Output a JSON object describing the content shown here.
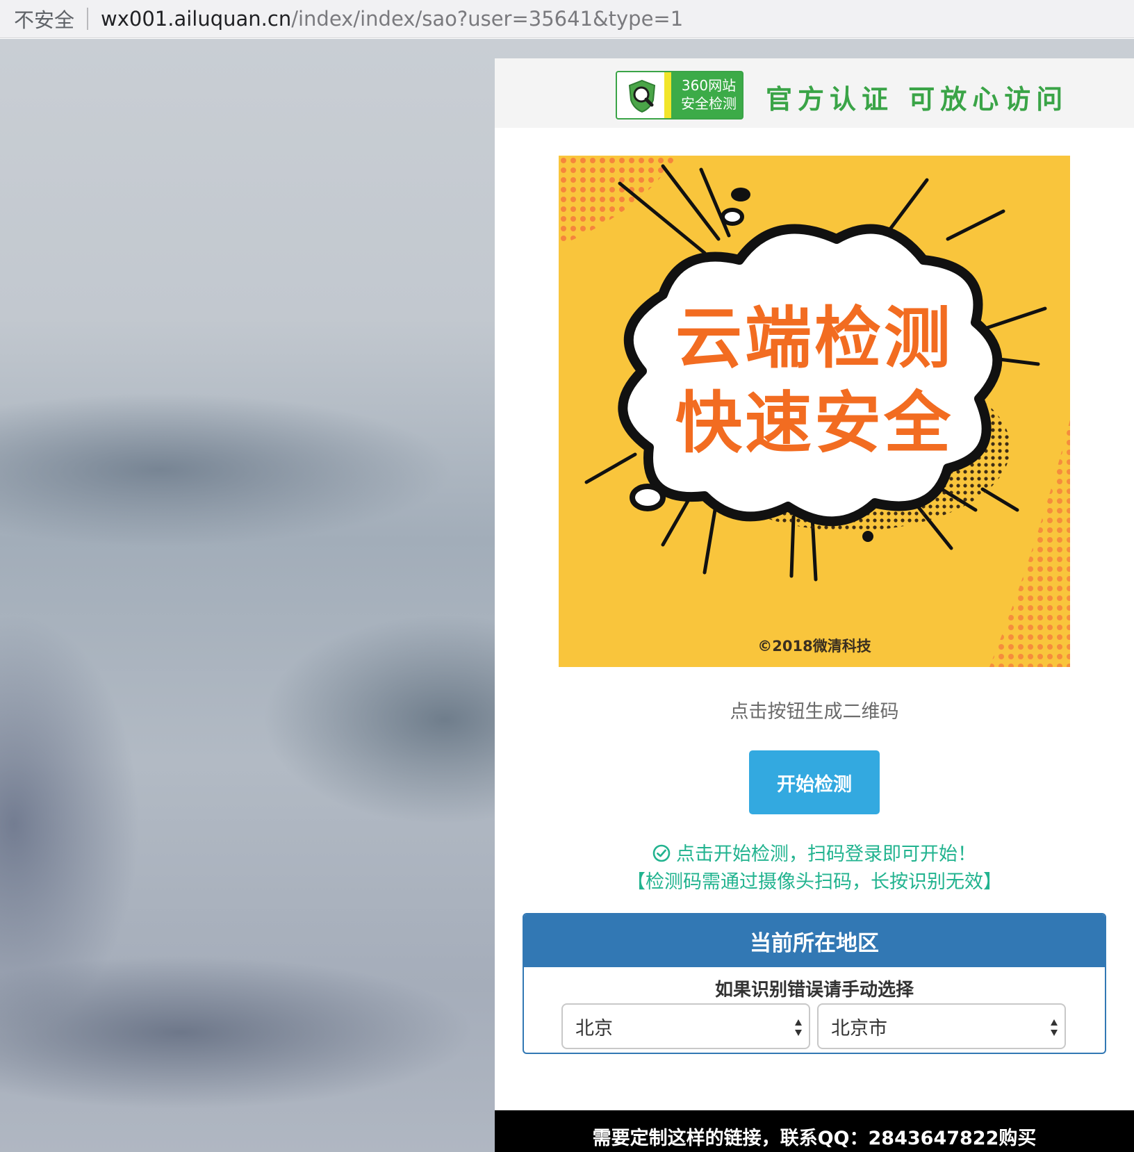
{
  "address_bar": {
    "security_label": "不安全",
    "host": "wx001.ailuquan.cn",
    "path": "/index/index/sao?user=35641&type=1"
  },
  "header": {
    "badge_line1": "360网站",
    "badge_line2": "安全检测",
    "slogan": "官方认证  可放心访问"
  },
  "hero": {
    "line1": "云端检测",
    "line2": "快速安全",
    "copyright": "©2018微清科技",
    "background_color": "#f9c53c",
    "text_color": "#f26c21"
  },
  "hint_text": "点击按钮生成二维码",
  "start_button_label": "开始检测",
  "notice": {
    "line1": "点击开始检测，扫码登录即可开始！",
    "line2": "【检测码需通过摄像头扫码，长按识别无效】",
    "icon": "check-circle-icon",
    "color": "#22b38f"
  },
  "region": {
    "title": "当前所在地区",
    "subtitle": "如果识别错误请手动选择",
    "province": "北京",
    "city": "北京市",
    "accent_color": "#3278b4"
  },
  "footer_text": "需要定制这样的链接，联系QQ：2843647822购买",
  "colors": {
    "button": "#33a9e0",
    "badge_green": "#3aa447"
  }
}
